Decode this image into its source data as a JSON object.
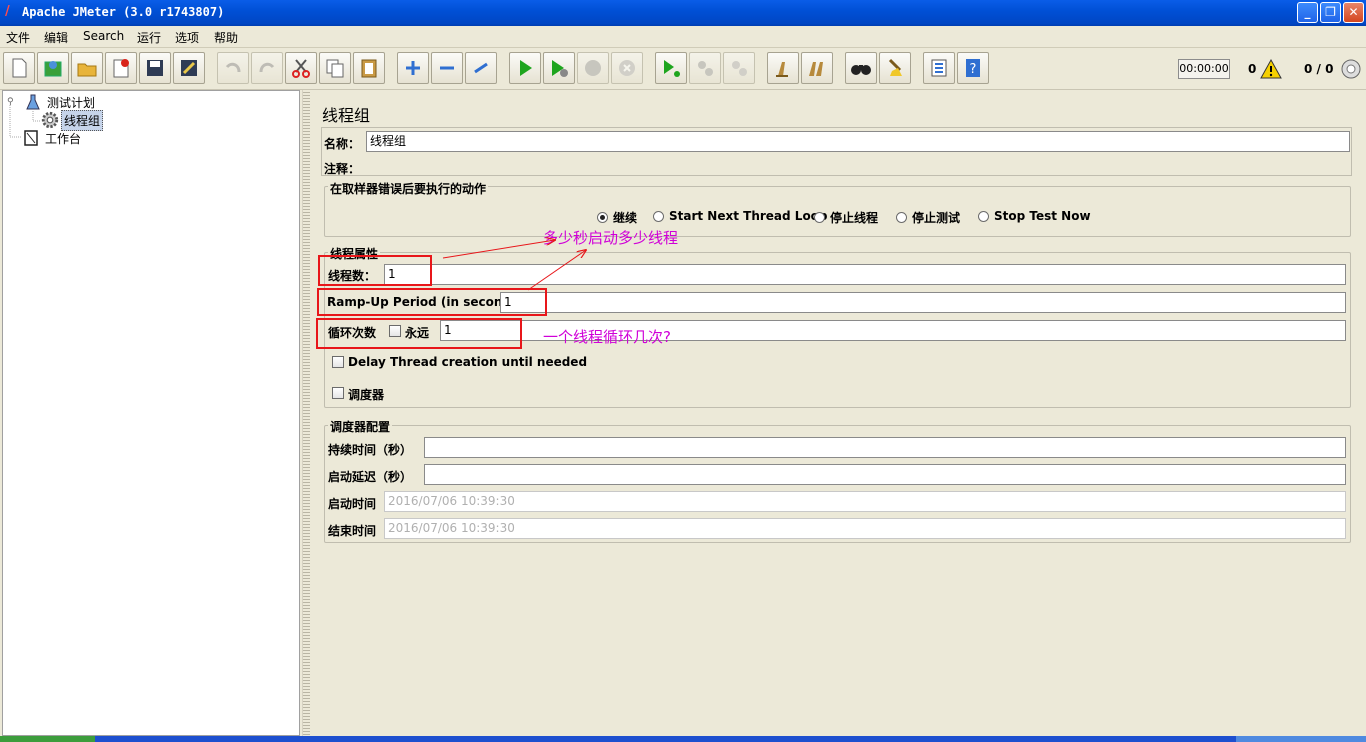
{
  "window": {
    "title": "Apache JMeter (3.0 r1743807)",
    "minimize": "_",
    "maximize": "❐",
    "close": "✕"
  },
  "menu": [
    "文件",
    "编辑",
    "Search",
    "运行",
    "选项",
    "帮助"
  ],
  "toolbar": {
    "icons": [
      "new-icon",
      "templates-icon",
      "open-icon",
      "close-icon",
      "save-icon",
      "save-as-icon",
      "undo-icon",
      "redo-icon",
      "cut-icon",
      "copy-icon",
      "paste-icon",
      "expand-icon",
      "collapse-icon",
      "toggle-icon",
      "start-icon",
      "start-no-pause-icon",
      "stop-icon",
      "shutdown-icon",
      "remote-start-icon",
      "remote-stop-icon",
      "remote-shutdown-icon",
      "clear-icon",
      "clear-all-icon",
      "search-icon",
      "reset-search-icon",
      "function-helper-icon",
      "help-icon"
    ],
    "timer": "00:00:00",
    "error_count": "0",
    "active_threads": "0 / 0"
  },
  "tree": {
    "nodes": [
      {
        "label": "测试计划"
      },
      {
        "label": "线程组"
      },
      {
        "label": "工作台"
      }
    ]
  },
  "panel": {
    "title": "线程组",
    "name_label": "名称：",
    "name_value": "线程组",
    "comment_label": "注释：",
    "error_group_title": "在取样器错误后要执行的动作",
    "radios": [
      "继续",
      "Start Next Thread Loop",
      "停止线程",
      "停止测试",
      "Stop Test Now"
    ],
    "thread_props_title": "线程属性",
    "threads_label": "线程数：",
    "threads_value": "1",
    "rampup_label": "Ramp-Up Period (in seconds):",
    "rampup_value": "1",
    "loop_label": "循环次数",
    "forever_label": "永远",
    "loop_value": "1",
    "delay_label": "Delay Thread creation until needed",
    "scheduler_label": "调度器",
    "scheduler_group_title": "调度器配置",
    "duration_label": "持续时间（秒）",
    "startup_delay_label": "启动延迟（秒）",
    "start_time_label": "启动时间",
    "start_time_value": "2016/07/06 10:39:30",
    "end_time_label": "结束时间",
    "end_time_value": "2016/07/06 10:39:30"
  },
  "annotations": {
    "note_rampup": "多少秒启动多少线程",
    "note_loop": "一个线程循环几次?"
  },
  "colors": {
    "annotation_red": "#e8161a",
    "annotation_magenta": "#d000d8",
    "titlebar_blue": "#0050d6"
  }
}
